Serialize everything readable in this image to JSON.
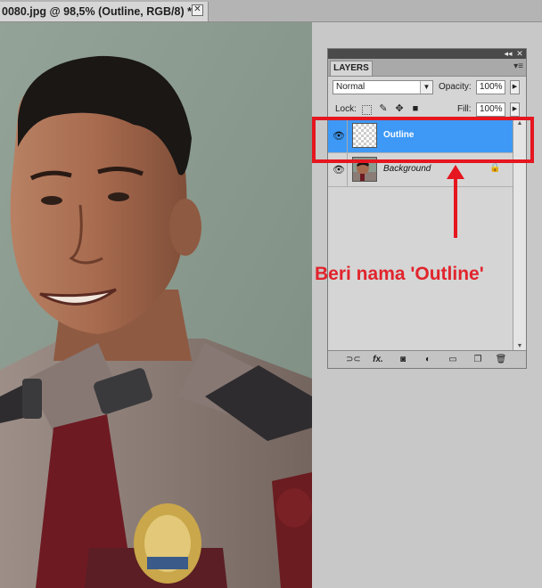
{
  "document": {
    "tab_title": "0080.jpg @ 98,5% (Outline, RGB/8) *",
    "close_label": "✕"
  },
  "layers_panel": {
    "collapse_icon": "◂◂",
    "close_icon": "✕",
    "tab_label": "LAYERS",
    "menu_icon": "▾≡",
    "blend_mode": "Normal",
    "opacity_label": "Opacity:",
    "opacity_value": "100%",
    "lock_label": "Lock:",
    "fill_label": "Fill:",
    "fill_value": "100%",
    "layers": [
      {
        "name": "Outline",
        "selected": true,
        "visible": true,
        "locked": false
      },
      {
        "name": "Background",
        "selected": false,
        "visible": true,
        "locked": true
      }
    ],
    "footer_icons": [
      "link-icon",
      "fx-icon",
      "mask-icon",
      "adjustment-icon",
      "group-folder-icon",
      "new-layer-icon",
      "trash-icon"
    ],
    "footer_fx_label": "fx."
  },
  "annotation": {
    "text": "Beri nama 'Outline'",
    "color": "#e1242c"
  },
  "colors": {
    "selection_blue": "#3d99f5",
    "highlight_red": "#e5161f"
  }
}
